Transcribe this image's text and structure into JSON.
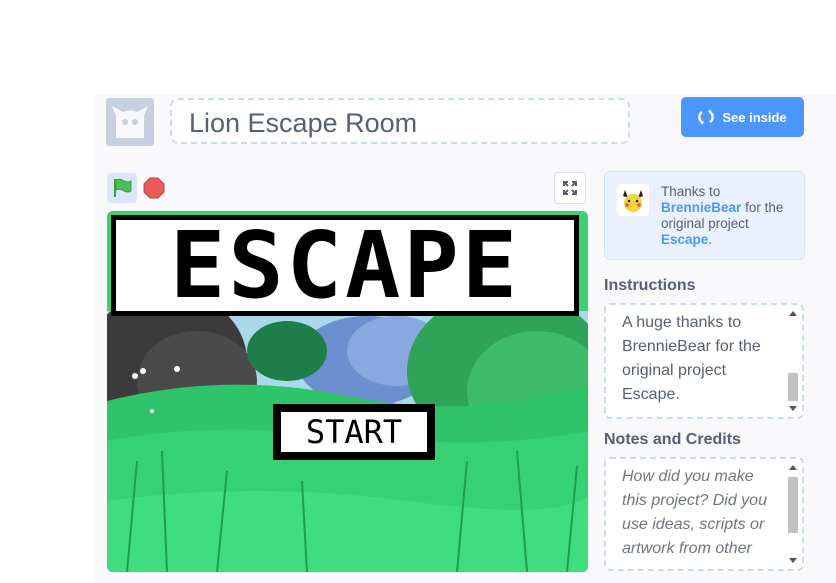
{
  "project": {
    "title": "Lion Escape Room"
  },
  "header": {
    "see_inside_label": "See inside"
  },
  "stage": {
    "escape_text": "ESCAPE",
    "start_text": "START"
  },
  "credits": {
    "prefix": "Thanks to",
    "author": "BrennieBear",
    "middle": "for the original project",
    "original_project": "Escape",
    "suffix": "."
  },
  "instructions": {
    "heading": "Instructions",
    "text": "A huge thanks to BrennieBear for the original project Escape."
  },
  "notes": {
    "heading": "Notes and Credits",
    "text": "How did you make this project? Did you use ideas, scripts or artwork from other"
  },
  "icons": {
    "avatar": "scratch-cat-icon",
    "see_inside": "remix-arrows-icon",
    "green_flag": "green-flag-icon",
    "stop": "stop-sign-icon",
    "fullscreen": "fullscreen-icon",
    "credit_avatar": "pikachu-avatar-icon"
  },
  "colors": {
    "accent_blue": "#4c97ff",
    "text": "#575e75",
    "flag_green": "#4cbf56",
    "stop_red": "#ec5959"
  }
}
